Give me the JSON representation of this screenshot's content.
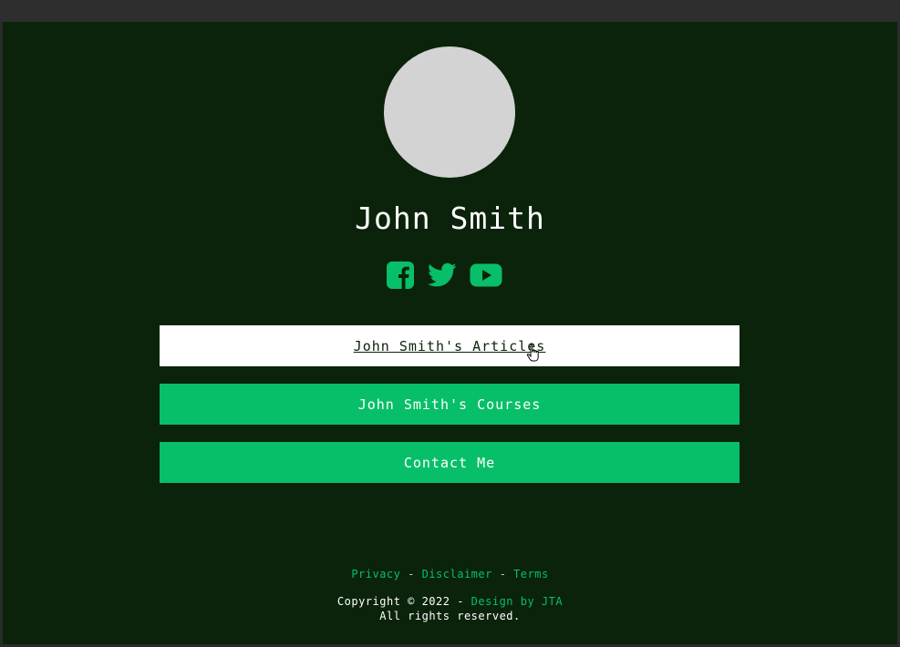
{
  "profile": {
    "name": "John Smith"
  },
  "socials": [
    {
      "icon": "facebook-icon"
    },
    {
      "icon": "twitter-icon"
    },
    {
      "icon": "youtube-icon"
    }
  ],
  "buttons": {
    "articles": "John Smith's Articles",
    "courses": "John Smith's Courses",
    "contact": "Contact Me"
  },
  "footer": {
    "privacy": "Privacy",
    "disclaimer": "Disclaimer",
    "terms": "Terms",
    "separator": "-",
    "copyright_prefix": "Copyright © 2022 -",
    "design_credit": "Design by JTA",
    "rights": "All rights reserved."
  },
  "colors": {
    "background": "#0a230a",
    "accent": "#08bf69",
    "avatar": "#d3d3d3",
    "frame": "#2e2e2e"
  }
}
